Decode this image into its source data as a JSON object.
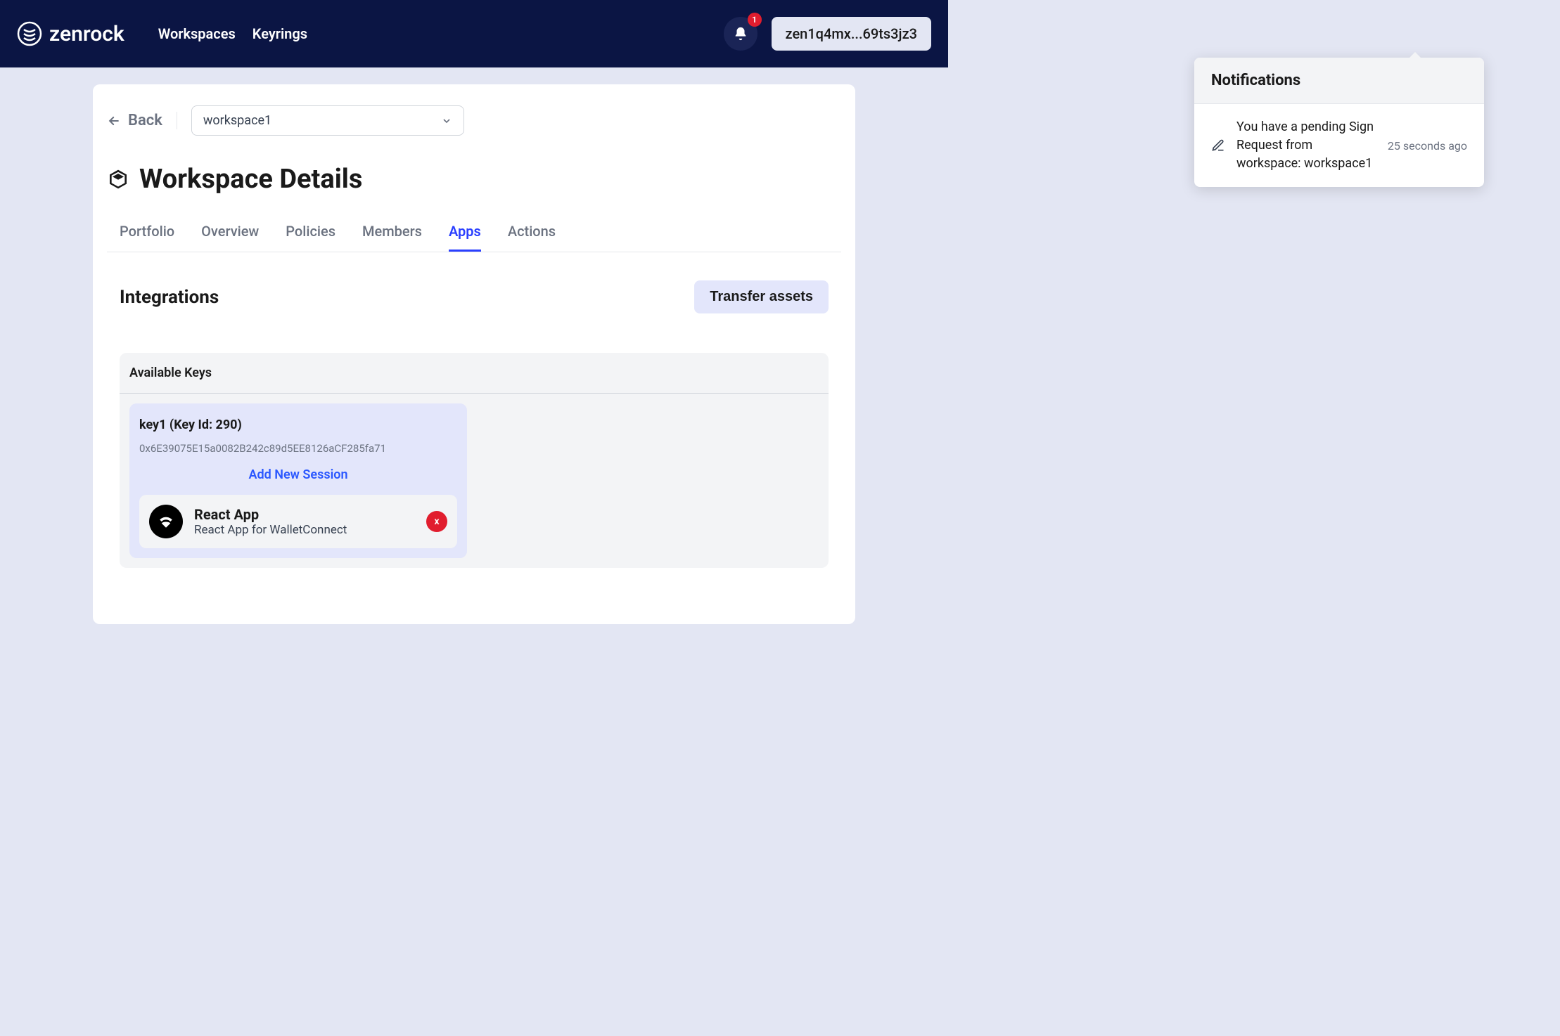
{
  "header": {
    "brand": "zenrock",
    "nav": {
      "workspaces": "Workspaces",
      "keyrings": "Keyrings"
    },
    "bell_badge": "1",
    "address": "zen1q4mx...69ts3jz3"
  },
  "notifications": {
    "title": "Notifications",
    "items": [
      {
        "text": "You have a pending Sign Request from workspace: workspace1",
        "time": "25 seconds ago"
      }
    ]
  },
  "page": {
    "back_label": "Back",
    "workspace_selected": "workspace1",
    "title": "Workspace Details"
  },
  "tabs": {
    "portfolio": "Portfolio",
    "overview": "Overview",
    "policies": "Policies",
    "members": "Members",
    "apps": "Apps",
    "actions": "Actions"
  },
  "integrations": {
    "title": "Integrations",
    "transfer_label": "Transfer assets"
  },
  "keys": {
    "panel_title": "Available Keys",
    "key_title": "key1 (Key Id: 290)",
    "key_address": "0x6E39075E15a0082B242c89d5EE8126aCF285fa71",
    "add_session": "Add New Session",
    "session": {
      "name": "React App",
      "desc": "React App for WalletConnect",
      "remove": "x"
    }
  }
}
